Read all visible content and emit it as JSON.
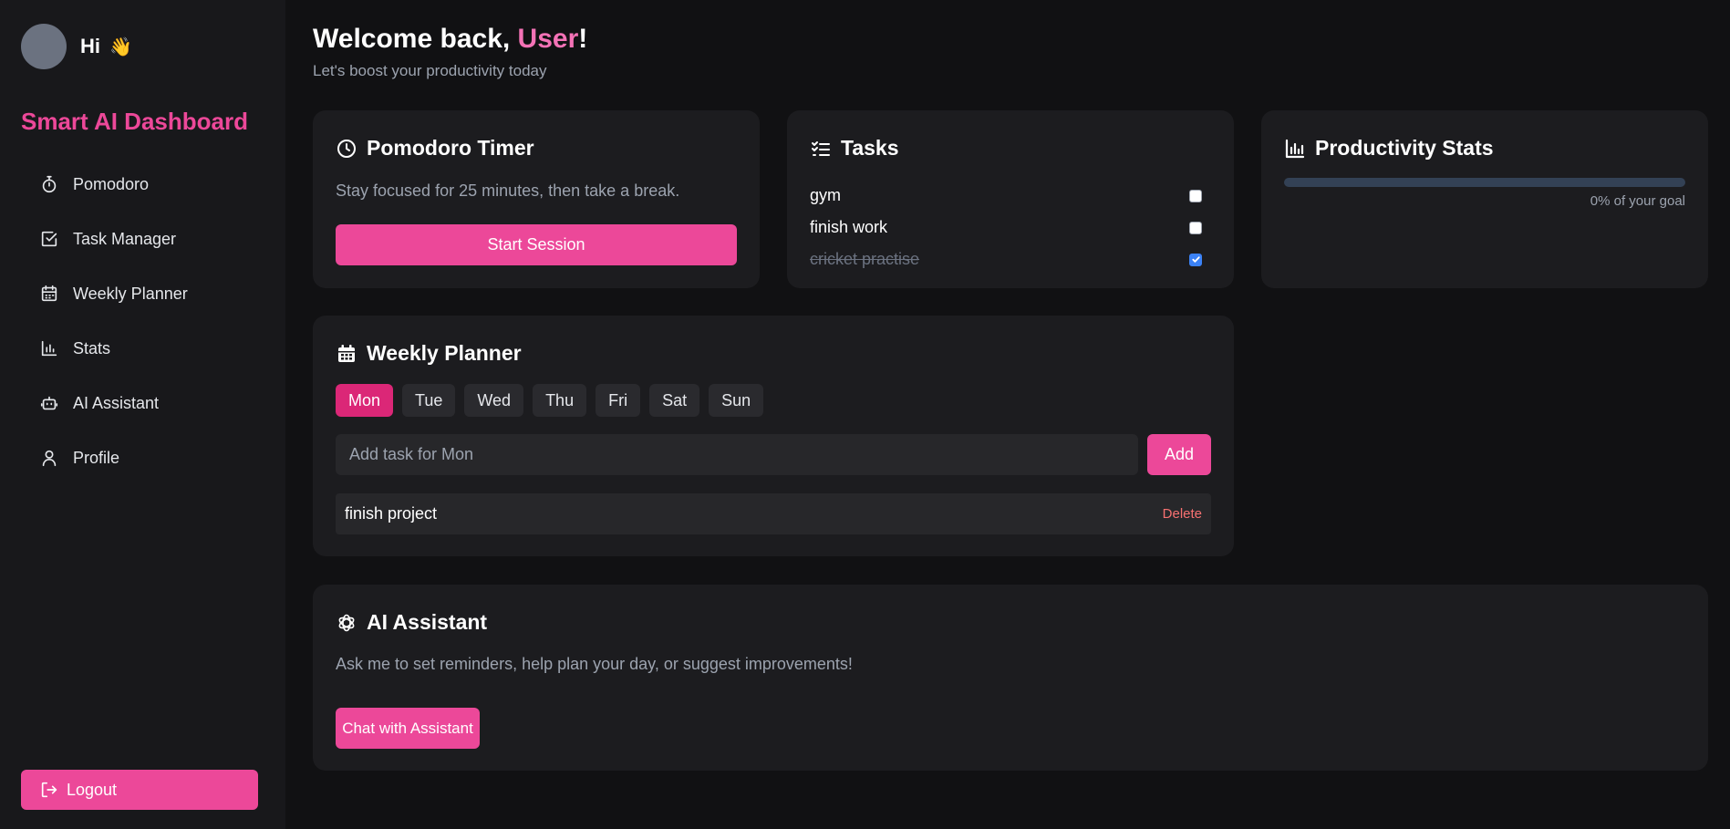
{
  "sidebar": {
    "greeting": "Hi",
    "wave": "👋",
    "brand": "Smart AI Dashboard",
    "items": [
      {
        "label": "Pomodoro",
        "icon": "timer-icon"
      },
      {
        "label": "Task Manager",
        "icon": "checkbox-icon"
      },
      {
        "label": "Weekly Planner",
        "icon": "calendar-icon"
      },
      {
        "label": "Stats",
        "icon": "bar-chart-icon"
      },
      {
        "label": "AI Assistant",
        "icon": "robot-icon"
      },
      {
        "label": "Profile",
        "icon": "user-icon"
      }
    ],
    "logout_label": "Logout"
  },
  "header": {
    "welcome_prefix": "Welcome back, ",
    "user_name": "User",
    "welcome_suffix": "!",
    "subtitle": "Let's boost your productivity today"
  },
  "pomodoro": {
    "title": "Pomodoro Timer",
    "description": "Stay focused for 25 minutes, then take a break.",
    "button_label": "Start Session"
  },
  "tasks": {
    "title": "Tasks",
    "items": [
      {
        "label": "gym",
        "done": false
      },
      {
        "label": "finish work",
        "done": false
      },
      {
        "label": "cricket practise",
        "done": true
      }
    ]
  },
  "stats": {
    "title": "Productivity Stats",
    "progress_fraction": 0,
    "progress_text": "0% of your goal"
  },
  "planner": {
    "title": "Weekly Planner",
    "days": [
      "Mon",
      "Tue",
      "Wed",
      "Thu",
      "Fri",
      "Sat",
      "Sun"
    ],
    "active_day": "Mon",
    "input_placeholder": "Add task for Mon",
    "add_label": "Add",
    "items": [
      {
        "label": "finish project",
        "delete_label": "Delete"
      }
    ]
  },
  "assistant": {
    "title": "AI Assistant",
    "description": "Ask me to set reminders, help plan your day, or suggest improvements!",
    "button_label": "Chat with Assistant"
  },
  "colors": {
    "accent": "#ec4899",
    "active_day": "#db2777",
    "background": "#111113",
    "card": "#1c1c1f"
  }
}
